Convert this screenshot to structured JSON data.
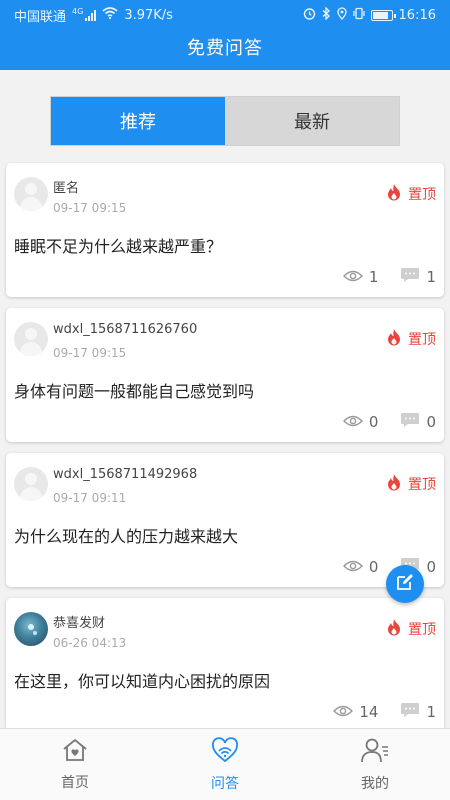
{
  "status_bar": {
    "carrier": "中国联通",
    "network_type": "4G",
    "speed": "3.97K/s",
    "time": "16:16"
  },
  "header": {
    "title": "免费问答"
  },
  "segment": {
    "recommend_label": "推荐",
    "latest_label": "最新",
    "active": "推荐"
  },
  "posts": [
    {
      "user": "匿名",
      "date": "09-17 09:15",
      "pin_label": "置顶",
      "question": "睡眠不足为什么越来越严重？",
      "views": "1",
      "comments": "1"
    },
    {
      "user": "wdxl_1568711626760",
      "date": "09-17 09:15",
      "pin_label": "置顶",
      "question": "身体有问题一般都能自己感觉到吗",
      "views": "0",
      "comments": "0"
    },
    {
      "user": "wdxl_1568711492968",
      "date": "09-17 09:11",
      "pin_label": "置顶",
      "question": "为什么现在的人的压力越来越大",
      "views": "0",
      "comments": "0"
    },
    {
      "user": "恭喜发财",
      "date": "06-26 04:13",
      "pin_label": "置顶",
      "question": "在这里，你可以知道内心困扰的原因",
      "views": "14",
      "comments": "1"
    }
  ],
  "tabbar": {
    "home_label": "首页",
    "qa_label": "问答",
    "mine_label": "我的",
    "active": "问答"
  },
  "colors": {
    "primary": "#1f8ef1",
    "pin": "#e8453c"
  }
}
